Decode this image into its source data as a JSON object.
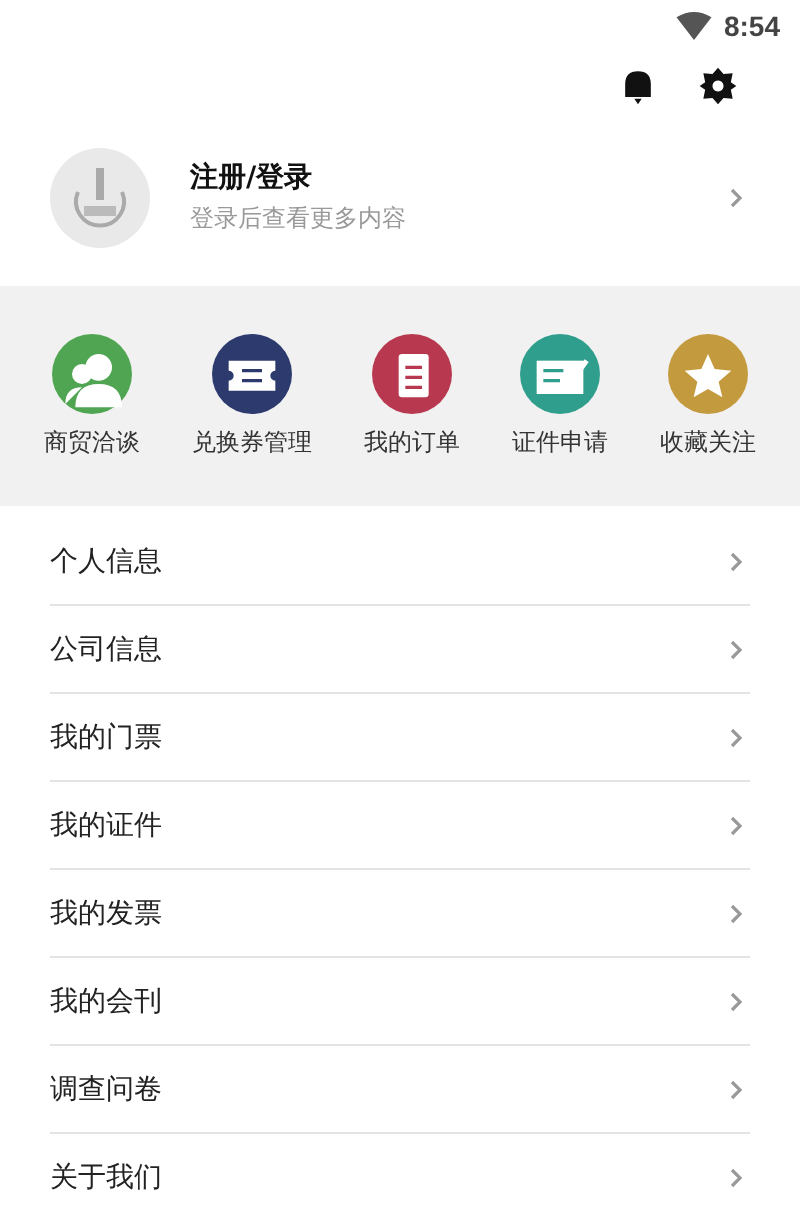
{
  "status_bar": {
    "time": "8:54"
  },
  "profile": {
    "title": "注册/登录",
    "subtitle": "登录后查看更多内容"
  },
  "shortcuts": [
    {
      "label": "商贸洽谈",
      "color": "#4fa552"
    },
    {
      "label": "兑换券管理",
      "color": "#2c3a6e"
    },
    {
      "label": "我的订单",
      "color": "#b8394f"
    },
    {
      "label": "证件申请",
      "color": "#2f9e8d"
    },
    {
      "label": "收藏关注",
      "color": "#c49a3f"
    }
  ],
  "menu": [
    {
      "label": "个人信息"
    },
    {
      "label": "公司信息"
    },
    {
      "label": "我的门票"
    },
    {
      "label": "我的证件"
    },
    {
      "label": "我的发票"
    },
    {
      "label": "我的会刊"
    },
    {
      "label": "调查问卷"
    },
    {
      "label": "关于我们"
    }
  ]
}
